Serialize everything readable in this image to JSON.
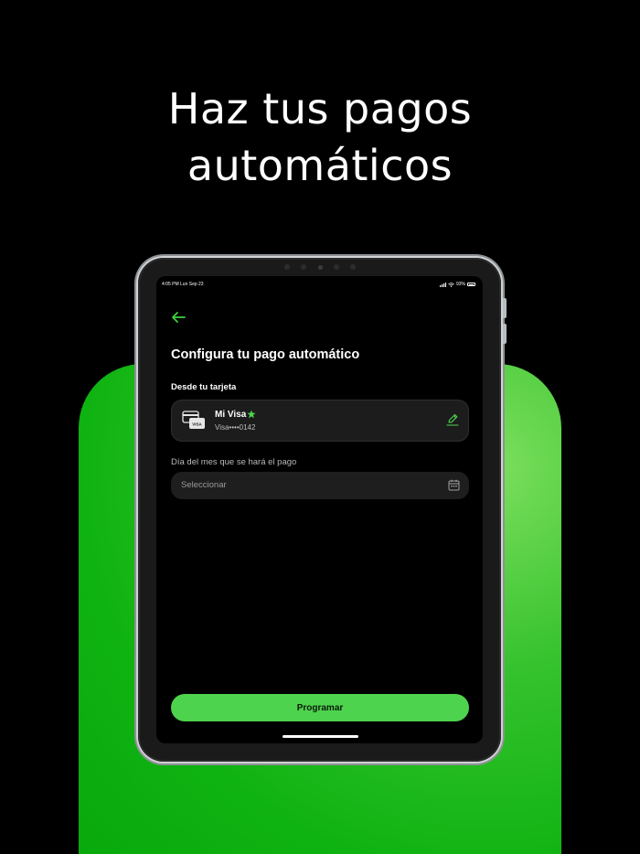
{
  "promo": {
    "headline_line1": "Haz tus pagos",
    "headline_line2": "automáticos"
  },
  "colors": {
    "accent": "#4ed34e",
    "panel_green": "#0fb311",
    "background": "#000000"
  },
  "status_bar": {
    "time_date": "4:05 PM  Lun Sep 23",
    "battery": "93%"
  },
  "screen": {
    "back_icon": "arrow-left-icon",
    "title": "Configura tu pago automático",
    "section_label": "Desde tu tarjeta",
    "card": {
      "icon": "credit-card-icon",
      "brand_badge": "VISA",
      "name": "Mi Visa",
      "favorite_icon": "star-icon",
      "number": "Visa••••0142",
      "edit_icon": "pencil-icon"
    },
    "day_field": {
      "label": "Día del mes que se hará el pago",
      "placeholder": "Seleccionar",
      "icon": "calendar-icon"
    },
    "submit_label": "Programar"
  }
}
